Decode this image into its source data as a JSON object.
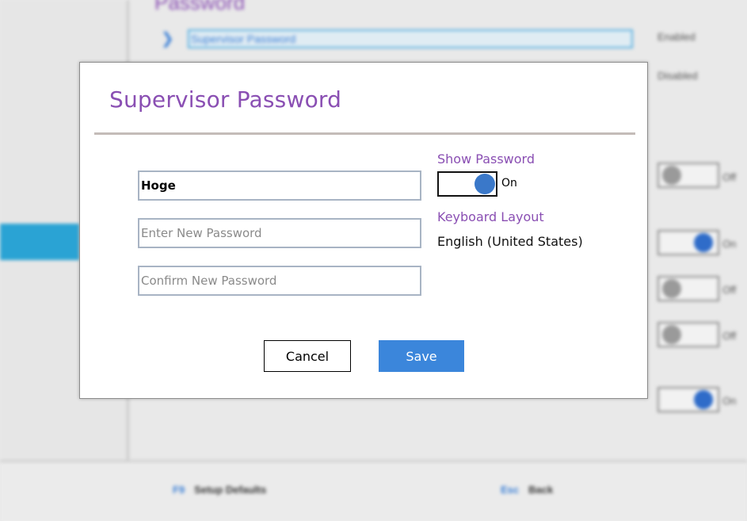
{
  "background": {
    "section_title": "Password",
    "items": [
      {
        "label": "Supervisor Password",
        "status": "Enabled"
      },
      {
        "label": "",
        "status": "Disabled"
      }
    ],
    "toggles": [
      {
        "state": "Off"
      },
      {
        "state": "On"
      },
      {
        "state": "Off"
      },
      {
        "state": "Off"
      },
      {
        "state": "On"
      }
    ],
    "footer": [
      {
        "key": "F9",
        "label": "Setup Defaults"
      },
      {
        "key": "Esc",
        "label": "Back"
      }
    ]
  },
  "dialog": {
    "title": "Supervisor Password",
    "current_password_value": "Hoge",
    "new_password_placeholder": "Enter New Password",
    "confirm_password_placeholder": "Confirm New Password",
    "show_password_label": "Show Password",
    "show_password_state": "On",
    "keyboard_layout_label": "Keyboard Layout",
    "keyboard_layout_value": "English (United States)",
    "cancel_label": "Cancel",
    "save_label": "Save"
  },
  "colors": {
    "accent_purple": "#8a4fb3",
    "primary_blue": "#3b86db",
    "toggle_knob": "#3a78c9"
  }
}
